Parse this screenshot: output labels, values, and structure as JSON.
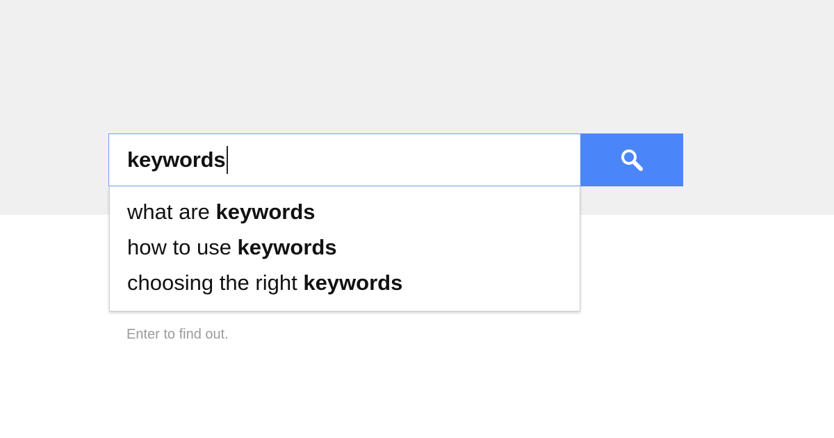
{
  "search": {
    "query": "keywords",
    "button_icon": "search-icon",
    "button_color": "#4a86f7",
    "focus_border_color": "#6d9cf5"
  },
  "suggestions": [
    {
      "prefix": "what are ",
      "match": "keywords"
    },
    {
      "prefix": "how to use ",
      "match": "keywords"
    },
    {
      "prefix": "choosing the right ",
      "match": "keywords"
    }
  ],
  "hint": "Enter to find out.",
  "colors": {
    "top_background": "#f0f0f0",
    "page_background": "#ffffff",
    "hint_text": "#9a9a9a"
  }
}
